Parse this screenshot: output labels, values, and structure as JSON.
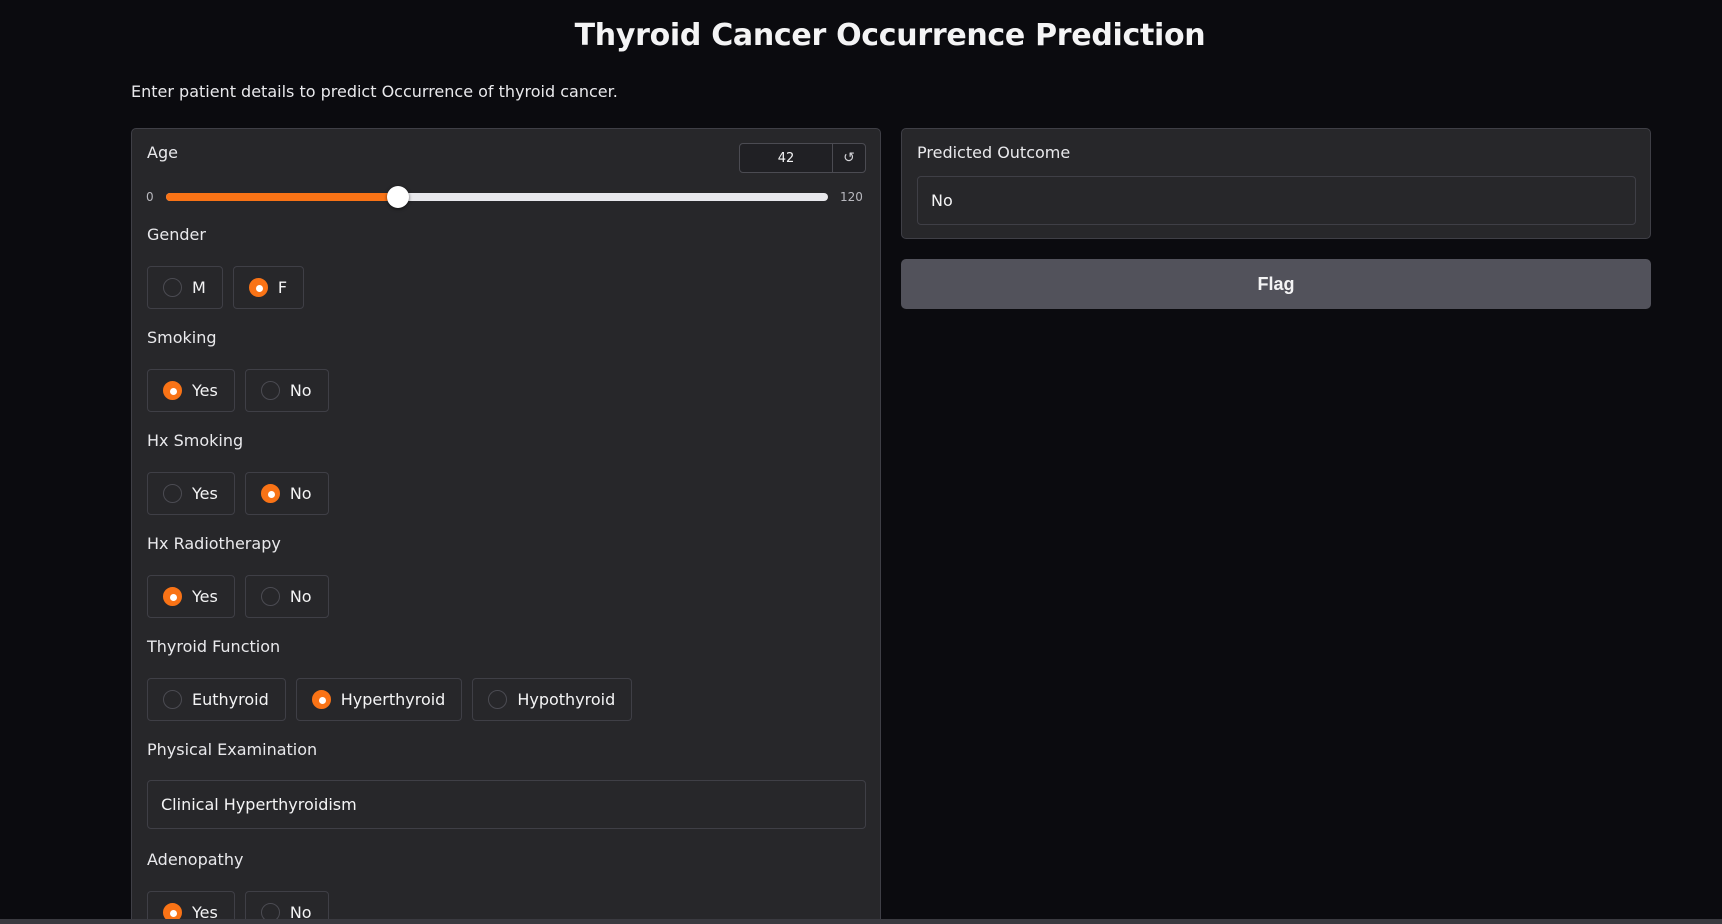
{
  "page": {
    "title": "Thyroid Cancer Occurrence Prediction",
    "subtitle": "Enter patient details to predict Occurrence of thyroid cancer."
  },
  "age": {
    "label": "Age",
    "value": 42,
    "value_text": "42",
    "min": 0,
    "max": 120,
    "min_text": "0",
    "max_text": "120",
    "reset_icon": "reset-icon"
  },
  "gender": {
    "label": "Gender",
    "options": [
      "M",
      "F"
    ],
    "selected": "F"
  },
  "smoking": {
    "label": "Smoking",
    "options": [
      "Yes",
      "No"
    ],
    "selected": "Yes"
  },
  "hx_smoking": {
    "label": "Hx Smoking",
    "options": [
      "Yes",
      "No"
    ],
    "selected": "No"
  },
  "hx_radiotherapy": {
    "label": "Hx Radiotherapy",
    "options": [
      "Yes",
      "No"
    ],
    "selected": "Yes"
  },
  "thyroid_function": {
    "label": "Thyroid Function",
    "options": [
      "Euthyroid",
      "Hyperthyroid",
      "Hypothyroid"
    ],
    "selected": "Hyperthyroid"
  },
  "physical_examination": {
    "label": "Physical Examination",
    "value": "Clinical Hyperthyroidism"
  },
  "adenopathy": {
    "label": "Adenopathy",
    "options": [
      "Yes",
      "No"
    ],
    "selected": "Yes"
  },
  "output": {
    "label": "Predicted Outcome",
    "value": "No"
  },
  "flag_button": {
    "label": "Flag"
  },
  "colors": {
    "accent": "#f97316",
    "panel": "#27272a",
    "background": "#0b0b0f",
    "button": "#52525b"
  }
}
